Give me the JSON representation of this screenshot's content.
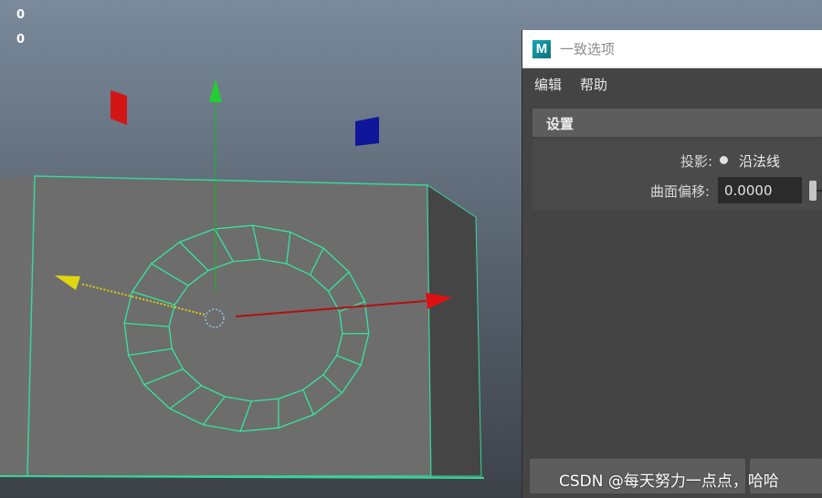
{
  "viewport": {
    "hud_line_1": "0",
    "hud_line_2": "0",
    "manipulator_colors": {
      "x_axis": "#cc1111",
      "y_axis": "#11aa22",
      "z_axis": "#d8cc11"
    },
    "handle_colors": {
      "left_plane": "#d41515",
      "right_plane": "#10169a"
    },
    "wireframe_color": "#33e6a0"
  },
  "window": {
    "app_icon": "maya-logo-icon",
    "app_icon_letter": "M",
    "title": "一致选项",
    "menu": [
      "编辑",
      "帮助"
    ],
    "section_title": "设置",
    "projection_label": "投影:",
    "projection_value": "沿法线",
    "surface_offset_label": "曲面偏移:",
    "surface_offset_value": "0.0000",
    "apply_button": "",
    "close_button": ""
  },
  "watermark": "CSDN @每天努力一点点，哈哈"
}
